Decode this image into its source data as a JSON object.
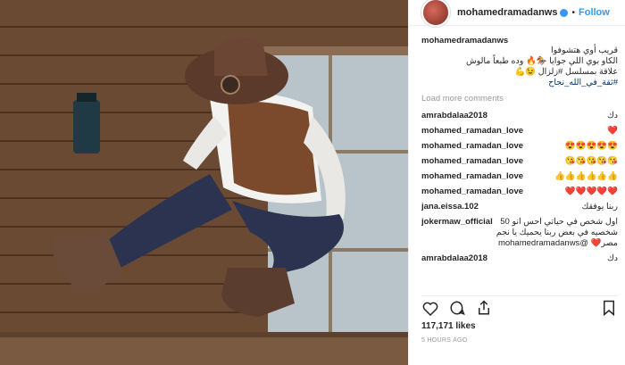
{
  "header": {
    "username": "mohamedramadanws",
    "separator": "•",
    "follow_label": "Follow"
  },
  "caption": {
    "username": "mohamedramadanws",
    "line1": "قريب أوي هتشوفوا",
    "line2": "الكاو بوي اللي جوايا 🏇🔥 وده طبعاً مالوش",
    "line3": "علاقة بمسلسل #زلزال 😉💪",
    "line4": "#ثقة_في_الله_نجاح"
  },
  "load_more": "Load more comments",
  "comments": [
    {
      "user": "amrabdalaa2018",
      "text": "دك"
    },
    {
      "user": "mohamed_ramadan_love",
      "text": "❤️"
    },
    {
      "user": "mohamed_ramadan_love",
      "text": "😍😍😍😍😍"
    },
    {
      "user": "mohamed_ramadan_love",
      "text": "😘😘😘😘😘"
    },
    {
      "user": "mohamed_ramadan_love",
      "text": "👍👍👍👍👍👍"
    },
    {
      "user": "mohamed_ramadan_love",
      "text": "❤️❤️❤️❤️❤️"
    },
    {
      "user": "jana.eissa.102",
      "text": "ربنا يوفقك"
    },
    {
      "user": "jokermaw_official",
      "text": "اول شخص في حياتي احس انو 50 شخصيه في بعض ربنا يحميك يا نجم مصر❤️ @mohamedramadanws"
    },
    {
      "user": "amrabdalaa2018",
      "text": "دك"
    }
  ],
  "likes": "117,171 likes",
  "time": "5 HOURS AGO",
  "icons": {
    "like": "heart-icon",
    "comment": "comment-icon",
    "share": "share-icon",
    "save": "bookmark-icon"
  }
}
